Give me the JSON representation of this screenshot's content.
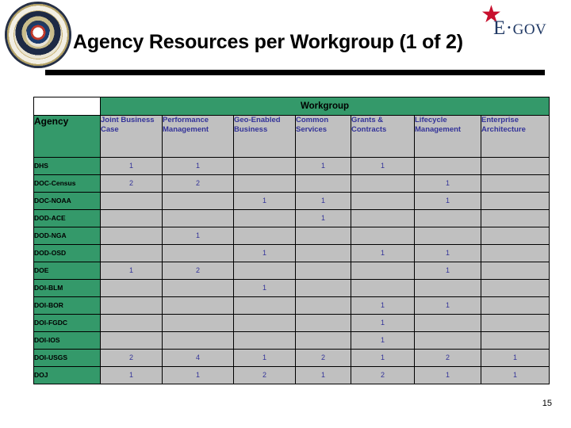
{
  "header": {
    "title": "Agency Resources per Workgroup (1 of 2)",
    "seal_name": "great-seal-of-the-united-states",
    "logo": {
      "star": "★",
      "text_main": "E·",
      "text_rest": "GOV",
      "full": "E·GOV",
      "color": "#1f3864",
      "star_color": "#c8102e"
    }
  },
  "table": {
    "group_header": "Workgroup",
    "agency_header": "Agency",
    "columns": [
      "Joint Business Case",
      "Performance Management",
      "Geo-Enabled Business",
      "Common Services",
      "Grants & Contracts",
      "Lifecycle Management",
      "Enterprise Architecture"
    ],
    "rows": [
      {
        "agency": "DHS",
        "values": [
          "1",
          "1",
          "",
          "1",
          "1",
          "",
          ""
        ]
      },
      {
        "agency": "DOC-Census",
        "values": [
          "2",
          "2",
          "",
          "",
          "",
          "1",
          ""
        ]
      },
      {
        "agency": "DOC-NOAA",
        "values": [
          "",
          "",
          "1",
          "1",
          "",
          "1",
          ""
        ]
      },
      {
        "agency": "DOD-ACE",
        "values": [
          "",
          "",
          "",
          "1",
          "",
          "",
          ""
        ]
      },
      {
        "agency": "DOD-NGA",
        "values": [
          "",
          "1",
          "",
          "",
          "",
          "",
          ""
        ]
      },
      {
        "agency": "DOD-OSD",
        "values": [
          "",
          "",
          "1",
          "",
          "1",
          "1",
          ""
        ]
      },
      {
        "agency": "DOE",
        "values": [
          "1",
          "2",
          "",
          "",
          "",
          "1",
          ""
        ]
      },
      {
        "agency": "DOI-BLM",
        "values": [
          "",
          "",
          "1",
          "",
          "",
          "",
          ""
        ]
      },
      {
        "agency": "DOI-BOR",
        "values": [
          "",
          "",
          "",
          "",
          "1",
          "1",
          ""
        ]
      },
      {
        "agency": "DOI-FGDC",
        "values": [
          "",
          "",
          "",
          "",
          "1",
          "",
          ""
        ]
      },
      {
        "agency": "DOI-IOS",
        "values": [
          "",
          "",
          "",
          "",
          "1",
          "",
          ""
        ]
      },
      {
        "agency": "DOI-USGS",
        "values": [
          "2",
          "4",
          "1",
          "2",
          "1",
          "2",
          "1"
        ]
      },
      {
        "agency": "DOJ",
        "values": [
          "1",
          "1",
          "2",
          "1",
          "2",
          "1",
          "1"
        ]
      }
    ]
  },
  "footer": {
    "page_number": "15"
  },
  "colors": {
    "green": "#34996a",
    "cell_gray": "#c0c0c0",
    "number_navy": "#333399",
    "column_header_navy": "#333399",
    "rule_black": "#000000"
  }
}
